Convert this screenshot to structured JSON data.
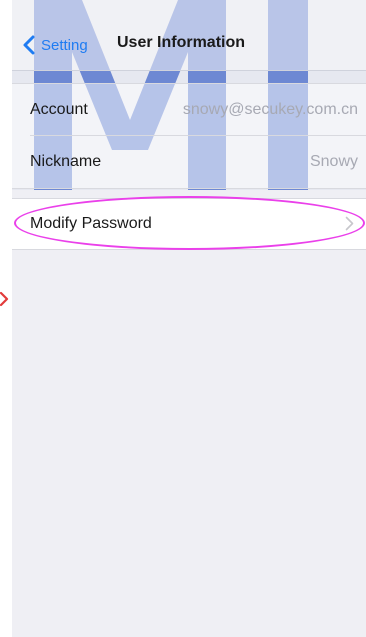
{
  "nav": {
    "back_label": "Setting",
    "title": "User Information"
  },
  "info": {
    "rows": [
      {
        "label": "Account",
        "value": "snowy@secukey.com.cn"
      },
      {
        "label": "Nickname",
        "value": "Snowy"
      }
    ]
  },
  "modify": {
    "label": "Modify Password"
  },
  "watermark": {
    "text": "MI"
  },
  "colors": {
    "accent": "#1f7cf2",
    "highlight": "#ea40ea",
    "arrow": "#e23b3b",
    "watermark": "#3f63c8"
  },
  "icons": {
    "back": "chevron-left-icon",
    "disclosure": "chevron-right-icon",
    "annotation": "red-arrow-icon"
  }
}
